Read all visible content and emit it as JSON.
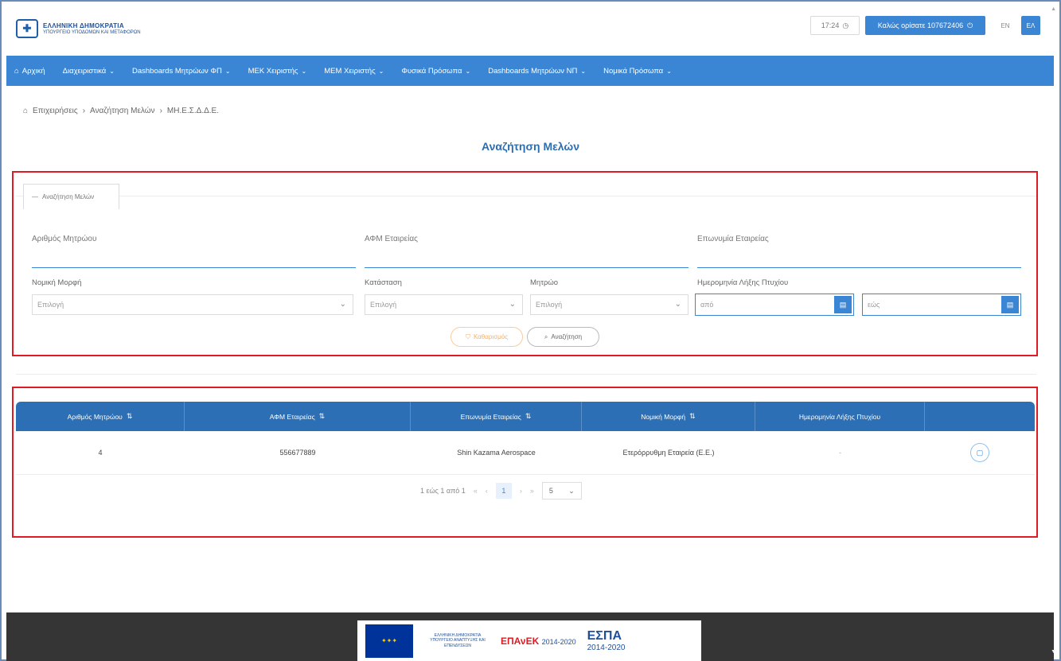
{
  "header": {
    "logo_line1": "ΕΛΛΗΝΙΚΗ ΔΗΜΟΚΡΑΤΙΑ",
    "logo_line2": "ΥΠΟΥΡΓΕΙΟ ΥΠΟΔΟΜΩΝ ΚΑΙ ΜΕΤΑΦΟΡΩΝ",
    "time": "17:24",
    "welcome": "Καλώς ορίσατε 107672406",
    "lang_en": "EN",
    "lang_el": "ΕΛ"
  },
  "nav": {
    "home": "Αρχική",
    "items": [
      "Διαχειριστικά",
      "Dashboards Μητρώων ΦΠ",
      "ΜΕΚ Χειριστής",
      "ΜΕΜ Χειριστής",
      "Φυσικά Πρόσωπα",
      "Dashboards Μητρώων ΝΠ",
      "Νομικά Πρόσωπα"
    ]
  },
  "breadcrumb": [
    "Επιχειρήσεις",
    "Αναζήτηση Μελών",
    "ΜΗ.Ε.Σ.Δ.Δ.Ε."
  ],
  "page_title": "Αναζήτηση Μελών",
  "search": {
    "legend": "Αναζήτηση Μελών",
    "registry_number_label": "Αριθμός Μητρώου",
    "tax_id_label": "ΑΦΜ Εταιρείας",
    "company_name_label": "Επωνυμία Εταιρείας",
    "legal_form_label": "Νομική Μορφή",
    "legal_form_value": "Επιλογή",
    "status_label": "Κατάσταση",
    "status_value": "Επιλογή",
    "registry_label": "Μητρώο",
    "registry_value": "Επιλογή",
    "expiry_label": "Ημερομηνία Λήξης Πτυχίου",
    "from_placeholder": "από",
    "to_placeholder": "εώς",
    "clear_label": "Καθαρισμός",
    "search_label": "Αναζήτηση"
  },
  "table": {
    "columns": [
      "Αριθμός Μητρώου",
      "ΑΦΜ Εταιρείας",
      "Επωνυμία Εταιρείας",
      "Νομική Μορφή",
      "Ημερομηνία Λήξης Πτυχίου",
      ""
    ],
    "rows": [
      {
        "registry_number": "4",
        "tax_id": "556677889",
        "company_name": "Shin Kazama Aerospace",
        "legal_form": "Ετερόρρυθμη Εταιρεία (Ε.Ε.)",
        "expiry_date": "-"
      }
    ]
  },
  "pager": {
    "summary": "1 εώς 1 από 1",
    "current_page": "1",
    "page_size": "5"
  },
  "footer": {
    "ministry": "ΕΛΛΗΝΙΚΗ ΔΗΜΟΚΡΑΤΙΑ ΥΠΟΥΡΓΕΙΟ ΑΝΑΠΤΥΞΗΣ ΚΑΙ ΕΠΕΝΔΥΣΕΩΝ",
    "epanek": "ΕΠΑνΕΚ",
    "epanek_years": "2014-2020",
    "espa": "ΕΣΠΑ",
    "espa_years": "2014-2020"
  },
  "colors": {
    "primary": "#3b86d4",
    "table_header": "#2d6fb4",
    "highlight_border": "#e01b24",
    "footer": "#353535"
  }
}
